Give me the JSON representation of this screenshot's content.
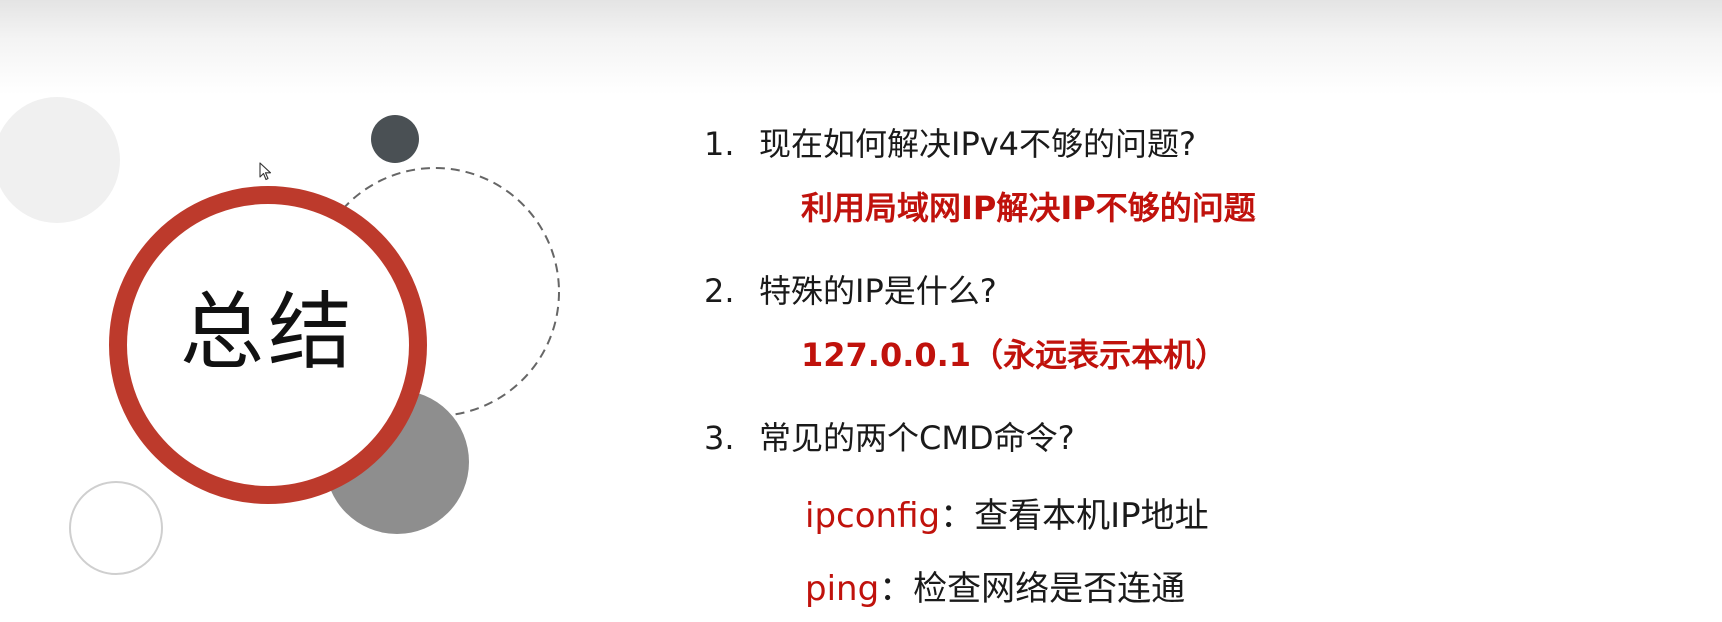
{
  "slide": {
    "title": "总结",
    "items": [
      {
        "number": "1.",
        "question": "现在如何解决IPv4不够的问题?",
        "answer": "利用局域网IP解决IP不够的问题"
      },
      {
        "number": "2.",
        "question": "特殊的IP是什么?",
        "answer": "127.0.0.1（永远表示本机）"
      },
      {
        "number": "3.",
        "question": "常见的两个CMD命令?"
      }
    ],
    "commands": [
      {
        "name": "ipconfig",
        "separator": "：",
        "description": "查看本机IP地址"
      },
      {
        "name": "ping",
        "separator": "：",
        "description": "检查网络是否连通"
      }
    ]
  },
  "colors": {
    "accent_red": "#c0120c",
    "ring_red": "#bd3a2c",
    "dark_dot": "#4a5054",
    "gray_circle": "#8e8e8e",
    "light_circle": "#f0f0f0",
    "dash_stroke": "#666666"
  },
  "icons": {
    "cursor": "mouse-pointer-icon"
  }
}
